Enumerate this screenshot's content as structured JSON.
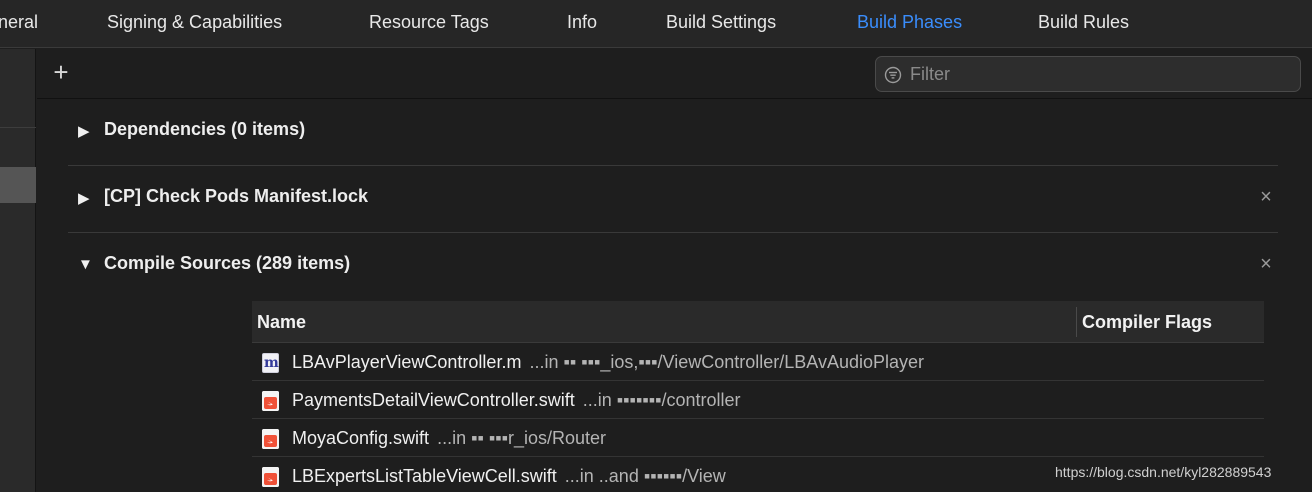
{
  "tabs": [
    {
      "label": "neral",
      "active": false
    },
    {
      "label": "Signing & Capabilities",
      "active": false
    },
    {
      "label": "Resource Tags",
      "active": false
    },
    {
      "label": "Info",
      "active": false
    },
    {
      "label": "Build Settings",
      "active": false
    },
    {
      "label": "Build Phases",
      "active": true
    },
    {
      "label": "Build Rules",
      "active": false
    }
  ],
  "toolbar": {
    "add_icon": "plus-icon",
    "filter": {
      "placeholder": "Filter",
      "value": "",
      "icon": "filter-icon"
    }
  },
  "phases": [
    {
      "title": "Dependencies (0 items)",
      "expanded": false,
      "closable": false
    },
    {
      "title": "[CP] Check Pods Manifest.lock",
      "expanded": false,
      "closable": true
    },
    {
      "title": "Compile Sources (289 items)",
      "expanded": true,
      "closable": true
    }
  ],
  "compile_sources": {
    "columns": [
      "Name",
      "Compiler Flags"
    ],
    "rows": [
      {
        "file": "LBAvPlayerViewController.m",
        "path": "...in ▪▪  ▪▪▪_ios,▪▪▪/ViewController/LBAvAudioPlayer",
        "type": "objc",
        "icon": "objc-file-icon"
      },
      {
        "file": "PaymentsDetailViewController.swift",
        "path": "...in ▪▪▪▪▪▪▪/controller",
        "type": "swift",
        "icon": "swift-file-icon"
      },
      {
        "file": "MoyaConfig.swift",
        "path": "...in ▪▪ ▪▪▪r_ios/Router",
        "type": "swift",
        "icon": "swift-file-icon"
      },
      {
        "file": "LBExpertsListTableViewCell.swift",
        "path": "...in ..and ▪▪▪▪▪▪/View",
        "type": "swift",
        "icon": "swift-file-icon"
      }
    ]
  },
  "watermark": "https://blog.csdn.net/kyl282889543",
  "colors": {
    "accent": "#3a8dfc",
    "background": "#1e1e1e",
    "swift": "#f05138"
  }
}
